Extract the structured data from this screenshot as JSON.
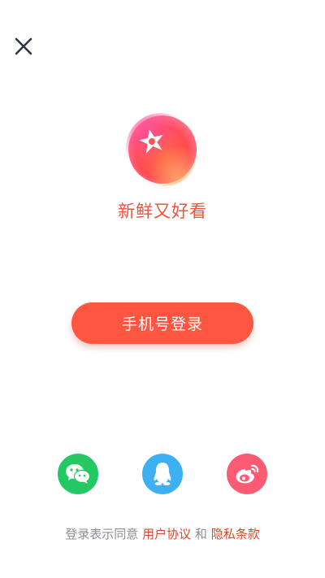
{
  "header": {
    "close_icon": "close-icon"
  },
  "brand": {
    "logo_icon": "star-logo-icon",
    "tagline": "新鲜又好看",
    "color": "#e9553f"
  },
  "login": {
    "phone_login_label": "手机号登录",
    "button_color": "#ff5641"
  },
  "social": {
    "wechat": {
      "icon": "wechat-icon",
      "color": "#25c964"
    },
    "qq": {
      "icon": "qq-icon",
      "color": "#3db0f4"
    },
    "weibo": {
      "icon": "weibo-icon",
      "color": "#fd5b74"
    }
  },
  "agreement": {
    "prefix": "登录表示同意",
    "user_agreement": "用户协议",
    "conjunction": "和",
    "privacy_policy": "隐私条款"
  }
}
